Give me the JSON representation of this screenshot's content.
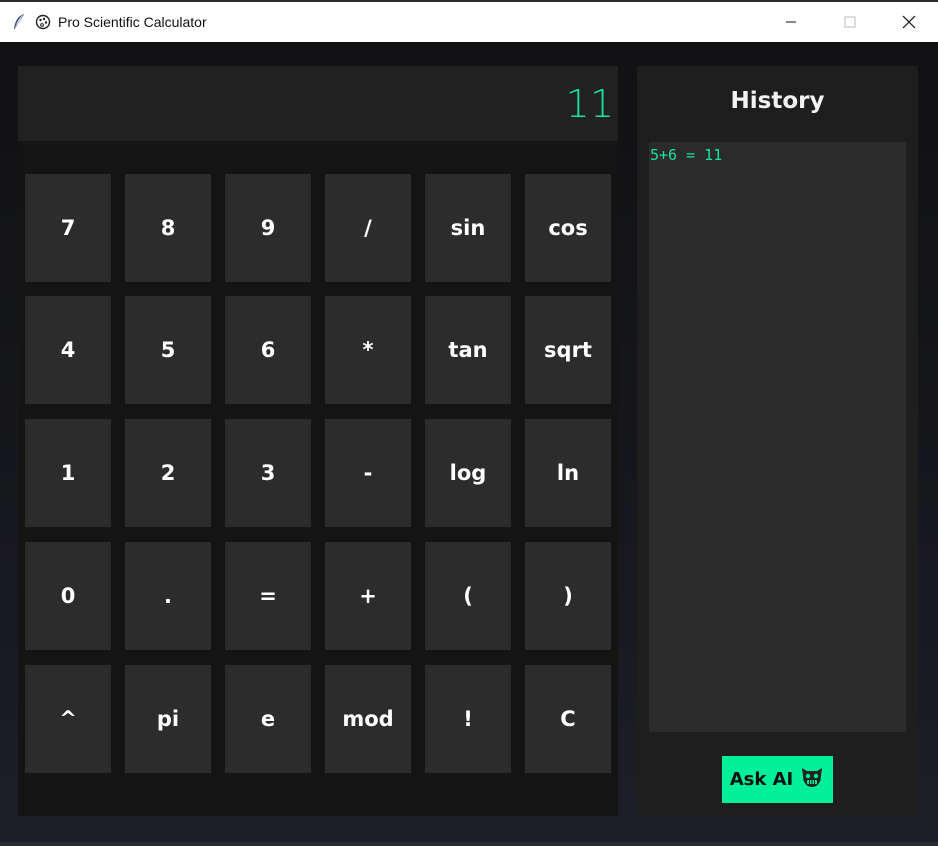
{
  "window": {
    "title": "Pro Scientific Calculator",
    "app_icon": "feather-icon",
    "app_icon2": "palette-icon",
    "controls": [
      "minimize-icon",
      "maximize-icon",
      "close-icon"
    ]
  },
  "display": {
    "value": "11"
  },
  "keys": [
    [
      "7",
      "8",
      "9",
      "/",
      "sin",
      "cos"
    ],
    [
      "4",
      "5",
      "6",
      "*",
      "tan",
      "sqrt"
    ],
    [
      "1",
      "2",
      "3",
      "-",
      "log",
      "ln"
    ],
    [
      "0",
      ".",
      "=",
      "+",
      "(",
      ")"
    ],
    [
      "^",
      "pi",
      "e",
      "mod",
      "!",
      "C"
    ]
  ],
  "history": {
    "title": "History",
    "entries": [
      "5+6 = 11"
    ]
  },
  "ask_ai": {
    "label": "Ask AI",
    "icon": "robot-face-icon"
  },
  "colors": {
    "accent": "#16e39a",
    "button_bg": "#2c2c2c",
    "panel_bg": "#141414",
    "ask_ai_bg": "#00f09a"
  }
}
